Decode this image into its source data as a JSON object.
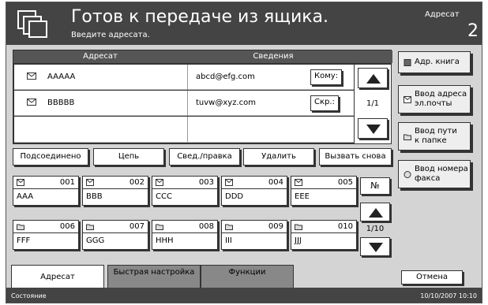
{
  "header": {
    "title": "Готов к передаче из ящика.",
    "subtitle": "Введите адресата.",
    "dest_label": "Адресат",
    "dest_count": "2"
  },
  "table": {
    "col_dest": "Адресат",
    "col_info": "Сведения",
    "rows": [
      {
        "name": "AAAAA",
        "info": "abcd@efg.com",
        "type": "Кому:"
      },
      {
        "name": "BBBBB",
        "info": "tuvw@xyz.com",
        "type": "Скр.:"
      }
    ],
    "pager": "1/1"
  },
  "side_buttons": {
    "addr_book": "Адр. книга",
    "email_entry": "Ввод адреса\nэл.почты",
    "folder_path": "Ввод пути\nк папке",
    "fax_number": "Ввод номера\nфакса"
  },
  "actions": {
    "connected": "Подсоединено",
    "chain": "Цепь",
    "details": "Свед./правка",
    "delete": "Удалить",
    "recall": "Вызвать снова"
  },
  "onetouch": {
    "no_label": "№",
    "pager": "1/10",
    "keys": [
      {
        "num": "001",
        "name": "AAA",
        "icon": "mail-icon"
      },
      {
        "num": "002",
        "name": "BBB",
        "icon": "mail-icon"
      },
      {
        "num": "003",
        "name": "CCC",
        "icon": "mail-icon"
      },
      {
        "num": "004",
        "name": "DDD",
        "icon": "mail-icon"
      },
      {
        "num": "005",
        "name": "EEE",
        "icon": "mail-icon"
      },
      {
        "num": "006",
        "name": "FFF",
        "icon": "folder-icon"
      },
      {
        "num": "007",
        "name": "GGG",
        "icon": "folder-icon"
      },
      {
        "num": "008",
        "name": "HHH",
        "icon": "folder-icon"
      },
      {
        "num": "009",
        "name": "III",
        "icon": "folder-icon"
      },
      {
        "num": "010",
        "name": "JJJ",
        "icon": "folder-icon"
      }
    ]
  },
  "tabs": {
    "destination": "Адресат",
    "quick_setup": "Быстрая настройка",
    "functions": "Функции"
  },
  "footer": {
    "cancel": "Отмена",
    "status": "Состояние",
    "datetime": "10/10/2007  10:10"
  }
}
